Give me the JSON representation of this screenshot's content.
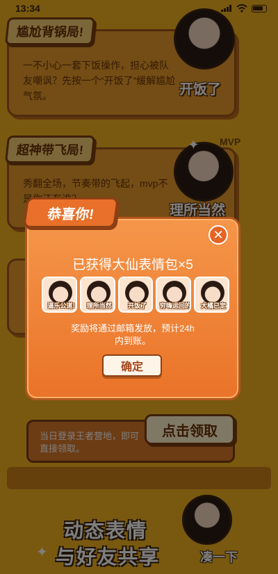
{
  "status": {
    "time": "13:34"
  },
  "background": {
    "card1": {
      "tag": "尴尬背锅局!",
      "text": "一不小心一套下饭操作，担心被队友嘲讽？先按一个“开饭了”缓解尴尬气氛。",
      "deco": "开饭了"
    },
    "card2": {
      "tag": "超神带飞局!",
      "text": "秀翻全场，节奏带的飞起，mvp不是你还有谁？",
      "deco": "理所当然",
      "mvp": "MVP"
    },
    "receive": {
      "text": "当日登录王者营地，即可直接领取。",
      "button": "点击领取"
    },
    "bottom": {
      "line1": "动态表情",
      "line2": "与好友共享",
      "side": "凑一下"
    }
  },
  "modal": {
    "tag": "恭喜你!",
    "title": "已获得大仙表情包×5",
    "close_icon": "close-icon",
    "stickers": [
      {
        "caption": "逼乐公道!"
      },
      {
        "caption": "理所当然"
      },
      {
        "caption": "开饭了"
      },
      {
        "caption": "穷嗨运回的"
      },
      {
        "caption": "大橘已定"
      }
    ],
    "description": "奖励将通过邮箱发放，预计24h内到账。",
    "confirm": "确定"
  },
  "colors": {
    "background": "#f3b21e",
    "modal": "#ea7328",
    "text_dark": "#6b3308"
  }
}
